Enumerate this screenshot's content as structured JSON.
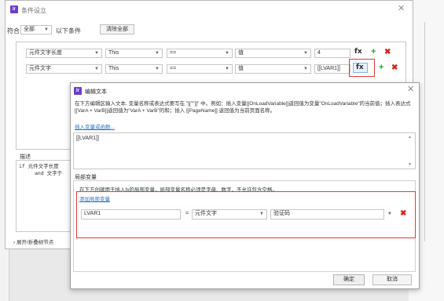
{
  "colors": {
    "brand": "#6a3fc9",
    "link": "#2b72c3",
    "highlight_red": "#e53935",
    "add_green": "#2f9e2f",
    "delete_red": "#d9251c"
  },
  "condition_dialog": {
    "logo": "Ir",
    "title": "条件设立",
    "match_label": "符合",
    "match_value": "全部",
    "match_suffix": "以下条件",
    "clear_all": "清除全部",
    "rows": [
      {
        "target": "元件文字长度",
        "object": "This",
        "operator": "==",
        "value_type": "值",
        "value": "4",
        "fx": "fx"
      },
      {
        "target": "元件文字",
        "object": "This",
        "operator": "==",
        "value_type": "值",
        "value": "[[LVAR1]]",
        "fx": "fx"
      }
    ],
    "description_label": "描述",
    "description_text_1": "if 元件文字长度 ",
    "description_text_2": "and 文字于",
    "expand_collapse": "展开/折叠树节点"
  },
  "edit_dialog": {
    "logo": "Ir",
    "title": "编辑文本",
    "instructions": "在下方编辑区输入文本, 变量名称或表达式要写在 \"[[\"\"]]\" 中。例如：插入变量[[OnLoadVariable]]返回值为变量\"OnLoadVariable\"的当前值；插入表达式[[VarA + VarB]]返回值为\"VarA + VarB\"的和；插入 [[PageName]] 返回值为当前页面名称。",
    "insert_link": "插入变量或函数...",
    "text_value": "[[LVAR1]]",
    "local_vars_label": "局部变量",
    "local_vars_hint": "在下方创建用于插入fx的局部变量，局部变量名称必须是字母、数字，不允许包含空格。",
    "add_local_var": "添加局部变量",
    "local_vars": [
      {
        "name": "LVAR1",
        "equals": "=",
        "type": "元件文字",
        "widget": "验证码"
      }
    ],
    "ok": "确定",
    "cancel": "取消"
  }
}
